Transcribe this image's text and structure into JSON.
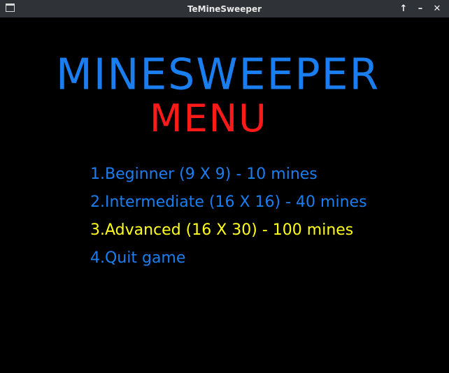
{
  "window": {
    "title": "TeMineSweeper",
    "controls": {
      "up": "↑",
      "minimize": "–",
      "close": "✕"
    }
  },
  "colors": {
    "title": "#1a7ef0",
    "subtitle": "#ff1a1a",
    "item": "#1a7ef0",
    "selected": "#ffff1a"
  },
  "game": {
    "title": "MINESWEEPER",
    "subtitle": "MENU"
  },
  "menu": {
    "items": [
      {
        "label": "1.Beginner (9 X 9) - 10 mines",
        "selected": false
      },
      {
        "label": "2.Intermediate (16 X 16) - 40 mines",
        "selected": false
      },
      {
        "label": "3.Advanced (16 X 30) - 100 mines",
        "selected": true
      },
      {
        "label": "4.Quit game",
        "selected": false
      }
    ]
  }
}
